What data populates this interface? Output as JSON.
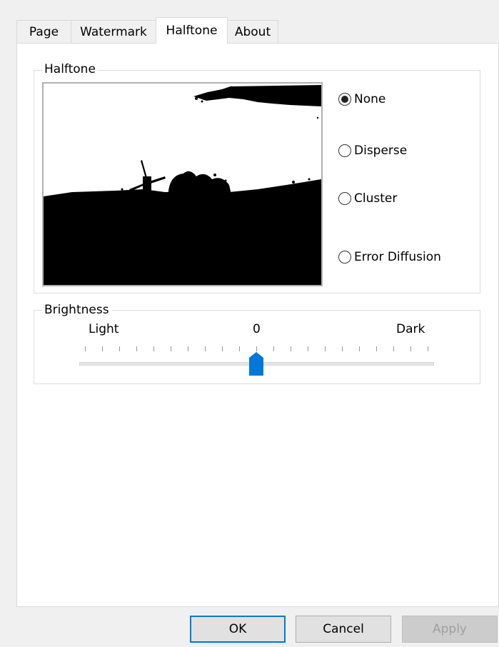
{
  "tabs": [
    {
      "label": "Page",
      "active": false
    },
    {
      "label": "Watermark",
      "active": false
    },
    {
      "label": "Halftone",
      "active": true
    },
    {
      "label": "About",
      "active": false
    }
  ],
  "halftone": {
    "group_title": "Halftone",
    "options": [
      {
        "label": "None",
        "checked": true
      },
      {
        "label": "Disperse",
        "checked": false
      },
      {
        "label": "Cluster",
        "checked": false
      },
      {
        "label": "Error Diffusion",
        "checked": false
      }
    ]
  },
  "brightness": {
    "group_title": "Brightness",
    "label_light": "Light",
    "label_zero": "0",
    "label_dark": "Dark",
    "value_fraction": 0.5,
    "thumb_color": "#0078d7"
  },
  "buttons": {
    "ok": "OK",
    "cancel": "Cancel",
    "apply": "Apply"
  }
}
